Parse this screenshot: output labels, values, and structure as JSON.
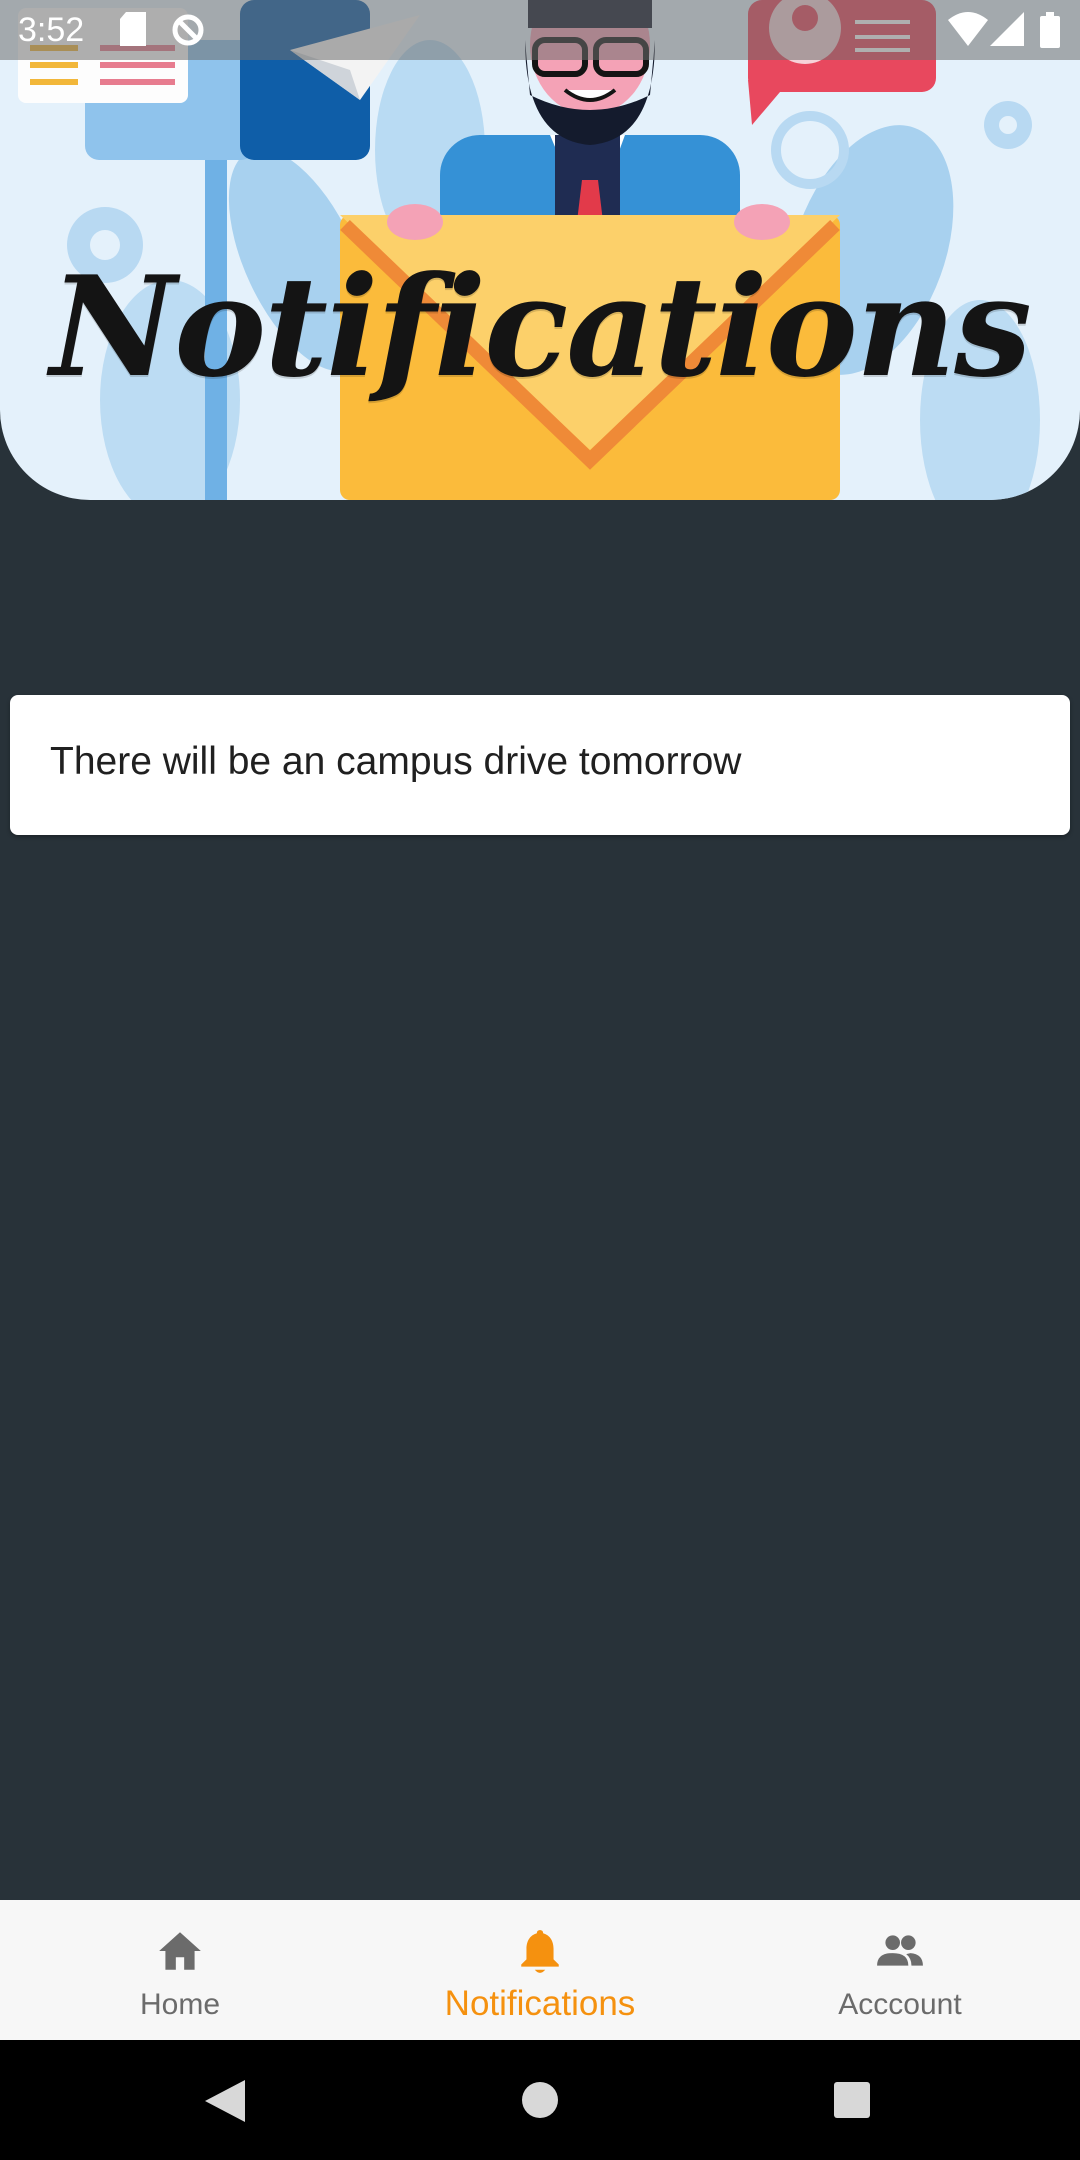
{
  "status_bar": {
    "time": "3:52"
  },
  "header": {
    "title": "Notifications"
  },
  "notifications": [
    {
      "text": "There will be an campus drive tomorrow"
    }
  ],
  "bottom_nav": {
    "items": [
      {
        "label": "Home",
        "icon": "home-icon",
        "active": false
      },
      {
        "label": "Notifications",
        "icon": "bell-icon",
        "active": true
      },
      {
        "label": "Acccount",
        "icon": "people-icon",
        "active": false
      }
    ],
    "active_color": "#f5910f",
    "inactive_color": "#6b6b6b"
  },
  "colors": {
    "background": "#283239",
    "card": "#ffffff"
  }
}
